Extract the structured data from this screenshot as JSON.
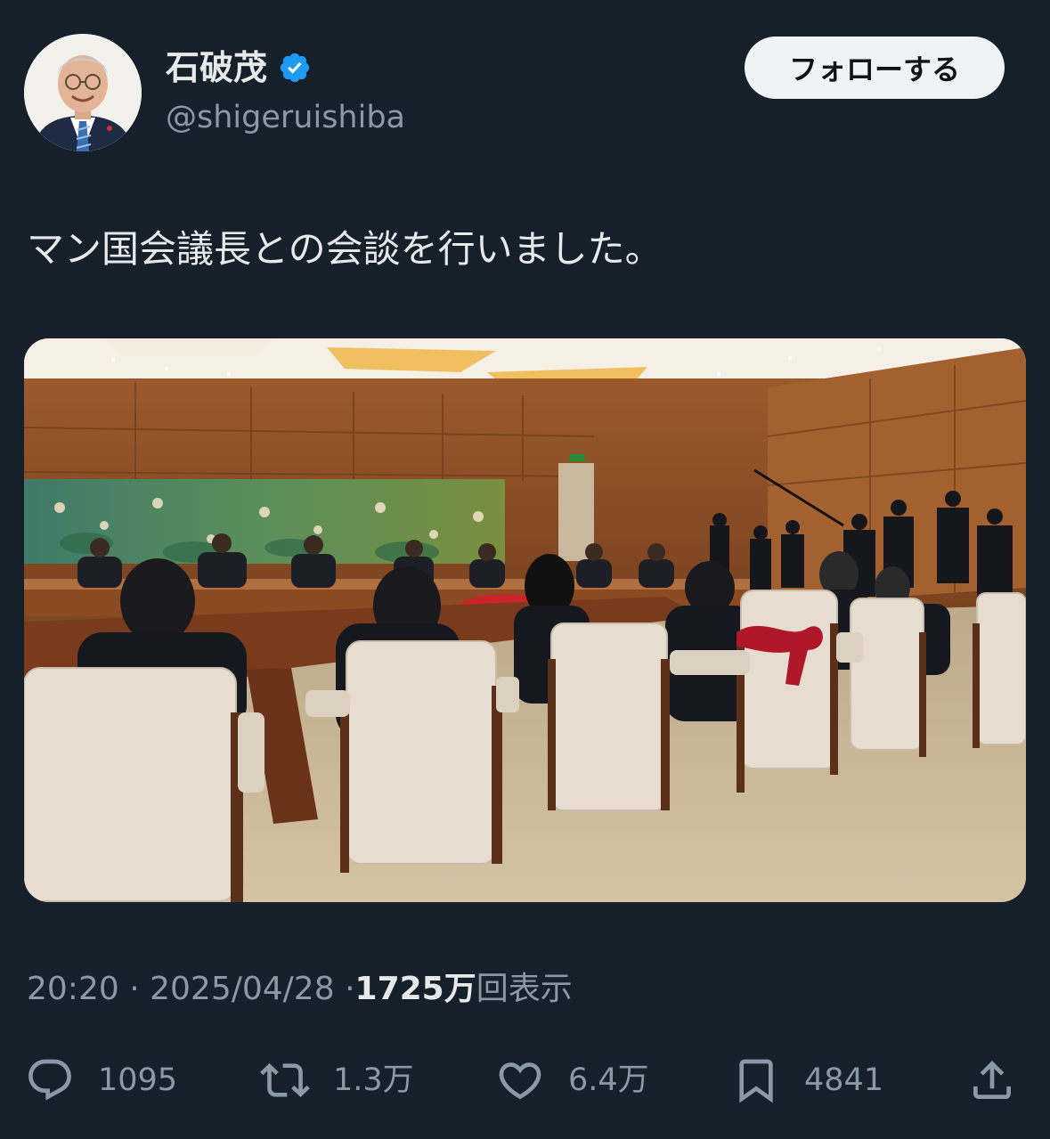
{
  "author": {
    "name": "石破茂",
    "handle": "@shigeruishiba",
    "verified": true,
    "verified_icon": "verified-badge-icon",
    "avatar_icon": "profile-photo"
  },
  "follow_button": {
    "label": "フォローする"
  },
  "tweet": {
    "text": "マン国会議長との会談を行いました。",
    "media_description": "photo-meeting-room"
  },
  "meta": {
    "time": "20:20",
    "separator": "·",
    "date": "2025/04/28",
    "views_count": "1725万",
    "views_label": "回表示"
  },
  "actions": {
    "reply": {
      "icon": "reply-icon",
      "count": "1095"
    },
    "retweet": {
      "icon": "retweet-icon",
      "count": "1.3万"
    },
    "like": {
      "icon": "like-icon",
      "count": "6.4万"
    },
    "bookmark": {
      "icon": "bookmark-icon",
      "count": "4841"
    },
    "share": {
      "icon": "share-icon"
    }
  },
  "colors": {
    "background": "#15202b",
    "text_primary": "#e7e9ea",
    "text_secondary": "#8b98a5",
    "verified_blue": "#1d9bf0",
    "button_bg": "#eff3f4"
  }
}
